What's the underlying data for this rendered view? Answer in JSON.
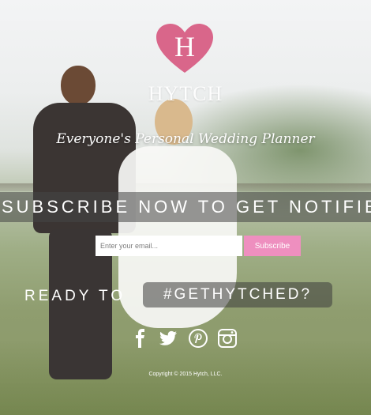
{
  "logo": {
    "letter": "H",
    "brand_name": "HYTCH",
    "heart_color": "#d9668a"
  },
  "tagline": "Everyone's Personal Wedding Planner",
  "banner": {
    "text": "SUBSCRIBE NOW TO GET NOTIFIE"
  },
  "signup": {
    "email_placeholder": "Enter your email...",
    "button_label": "Subscribe",
    "button_color": "#ee8fbf"
  },
  "ready": {
    "text": "READY TO",
    "hashtag": "#GETHYTCHED?"
  },
  "social": [
    "facebook-icon",
    "twitter-icon",
    "pinterest-icon",
    "instagram-icon"
  ],
  "footer": {
    "copyright": "Copyright © 2015 Hytch, LLC."
  }
}
